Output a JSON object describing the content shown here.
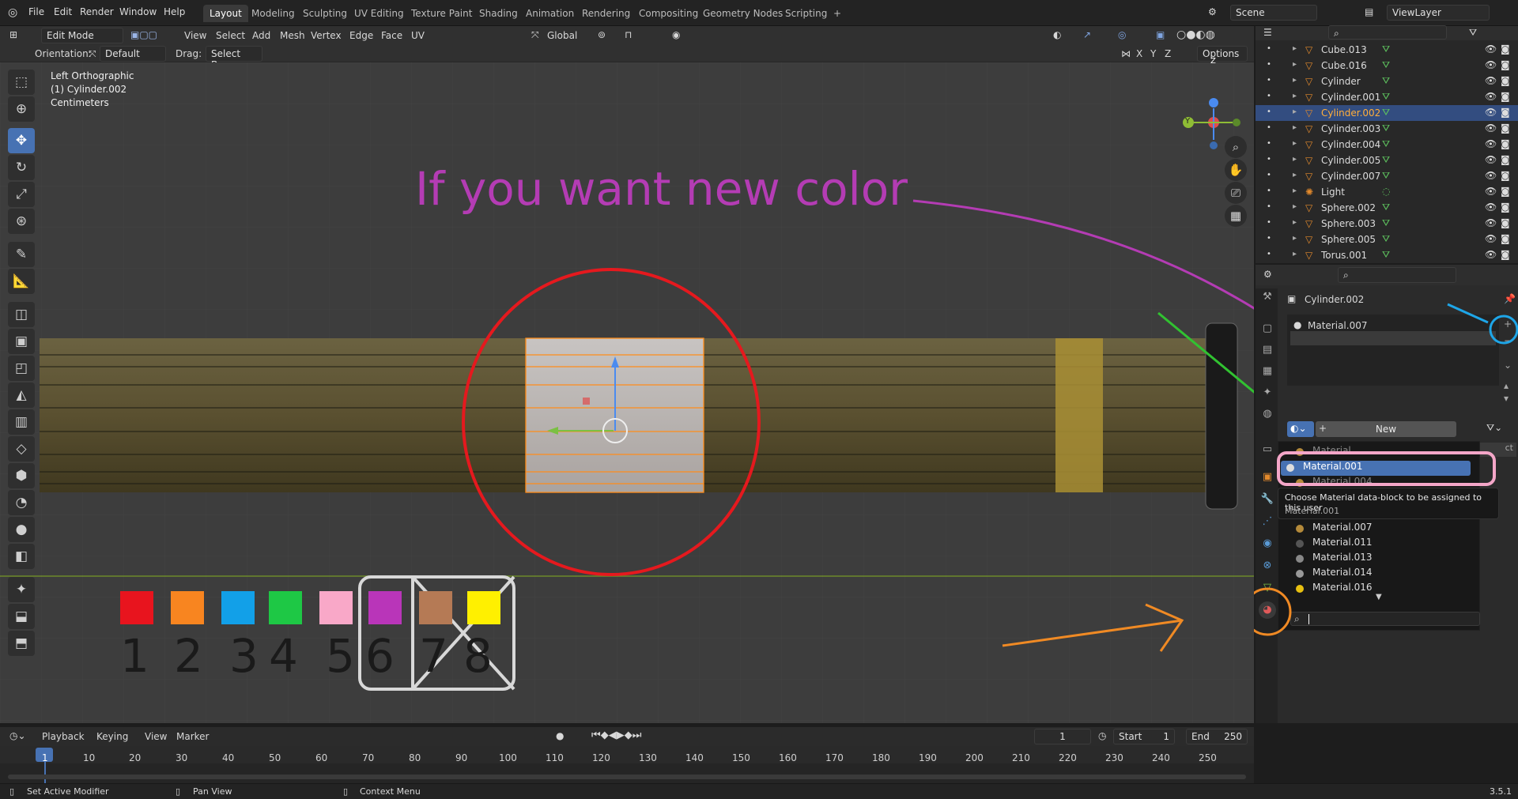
{
  "topbar": {
    "menus": [
      "File",
      "Edit",
      "Render",
      "Window",
      "Help"
    ],
    "workspaces": [
      "Layout",
      "Modeling",
      "Sculpting",
      "UV Editing",
      "Texture Paint",
      "Shading",
      "Animation",
      "Rendering",
      "Compositing",
      "Geometry Nodes",
      "Scripting"
    ],
    "add_tab": "+",
    "scene": "Scene",
    "view_layer": "ViewLayer"
  },
  "viewport_header": {
    "mode": "Edit Mode",
    "menus": [
      "View",
      "Select",
      "Add",
      "Mesh",
      "Vertex",
      "Edge",
      "Face",
      "UV"
    ],
    "transform": "Global",
    "axes": [
      "X",
      "Y",
      "Z"
    ],
    "options": "Options"
  },
  "tool_settings": {
    "orientation_label": "Orientation:",
    "orientation": "Default",
    "drag_label": "Drag:",
    "drag": "Select Box"
  },
  "overlay_info": {
    "view": "Left Orthographic",
    "object": "(1) Cylinder.002",
    "units": "Centimeters"
  },
  "gizmo": {
    "z": "Z",
    "y": "Y"
  },
  "annotation": {
    "text": "If you want new color",
    "color": "#b43cb4"
  },
  "swatches": {
    "colors": [
      "#e8141e",
      "#f88520",
      "#12a0e8",
      "#1ec845",
      "#f9a8c8",
      "#b935b9",
      "#b57a55",
      "#fff000"
    ],
    "numbers": [
      "1",
      "2",
      "3",
      "4",
      "5",
      "6",
      "7",
      "8"
    ]
  },
  "outliner": {
    "items": [
      {
        "name": "Cube.013"
      },
      {
        "name": "Cube.016"
      },
      {
        "name": "Cylinder"
      },
      {
        "name": "Cylinder.001"
      },
      {
        "name": "Cylinder.002",
        "selected": true
      },
      {
        "name": "Cylinder.003"
      },
      {
        "name": "Cylinder.004"
      },
      {
        "name": "Cylinder.005"
      },
      {
        "name": "Cylinder.007"
      },
      {
        "name": "Light"
      },
      {
        "name": "Sphere.002"
      },
      {
        "name": "Sphere.003"
      },
      {
        "name": "Sphere.005"
      },
      {
        "name": "Torus.001"
      }
    ]
  },
  "properties": {
    "object_name": "Cylinder.002",
    "material_slot": "Material.007",
    "new_button": "New",
    "clipped_text": "ct",
    "dropdown": {
      "items_top": [
        "Material",
        "Material.001",
        "Material.004"
      ],
      "selected": "Material.001",
      "tooltip_title": "Choose Material data-block to be assigned to this user",
      "tooltip_value": "Material.001",
      "items_bottom": [
        "Material.007",
        "Material.011",
        "Material.013",
        "Material.014",
        "Material.016"
      ],
      "search_placeholder": ""
    }
  },
  "timeline": {
    "menus": [
      "Playback",
      "Keying",
      "View",
      "Marker"
    ],
    "current_frame": "1",
    "start_label": "Start",
    "start": "1",
    "end_label": "End",
    "end": "250",
    "ticks": [
      "1",
      "10",
      "20",
      "30",
      "40",
      "50",
      "60",
      "70",
      "80",
      "90",
      "100",
      "110",
      "120",
      "130",
      "140",
      "150",
      "160",
      "170",
      "180",
      "190",
      "200",
      "210",
      "220",
      "230",
      "240",
      "250"
    ]
  },
  "statusbar": {
    "left": "Set Active Modifier",
    "middle": "Pan View",
    "right": "Context Menu",
    "version": "3.5.1"
  }
}
